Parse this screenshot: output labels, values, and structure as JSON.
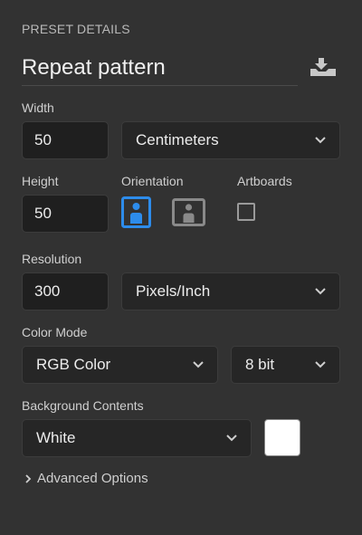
{
  "panel": {
    "title": "PRESET DETAILS",
    "preset_name": "Repeat pattern"
  },
  "width": {
    "label": "Width",
    "value": "50",
    "unit": "Centimeters"
  },
  "height": {
    "label": "Height",
    "value": "50"
  },
  "orientation": {
    "label": "Orientation",
    "selected": "portrait"
  },
  "artboards": {
    "label": "Artboards",
    "checked": false
  },
  "resolution": {
    "label": "Resolution",
    "value": "300",
    "unit": "Pixels/Inch"
  },
  "color_mode": {
    "label": "Color Mode",
    "mode": "RGB Color",
    "depth": "8 bit"
  },
  "background": {
    "label": "Background Contents",
    "value": "White",
    "swatch_color": "#ffffff"
  },
  "advanced": {
    "label": "Advanced Options"
  },
  "colors": {
    "accent": "#2d8ceb",
    "panel_bg": "#323232"
  }
}
